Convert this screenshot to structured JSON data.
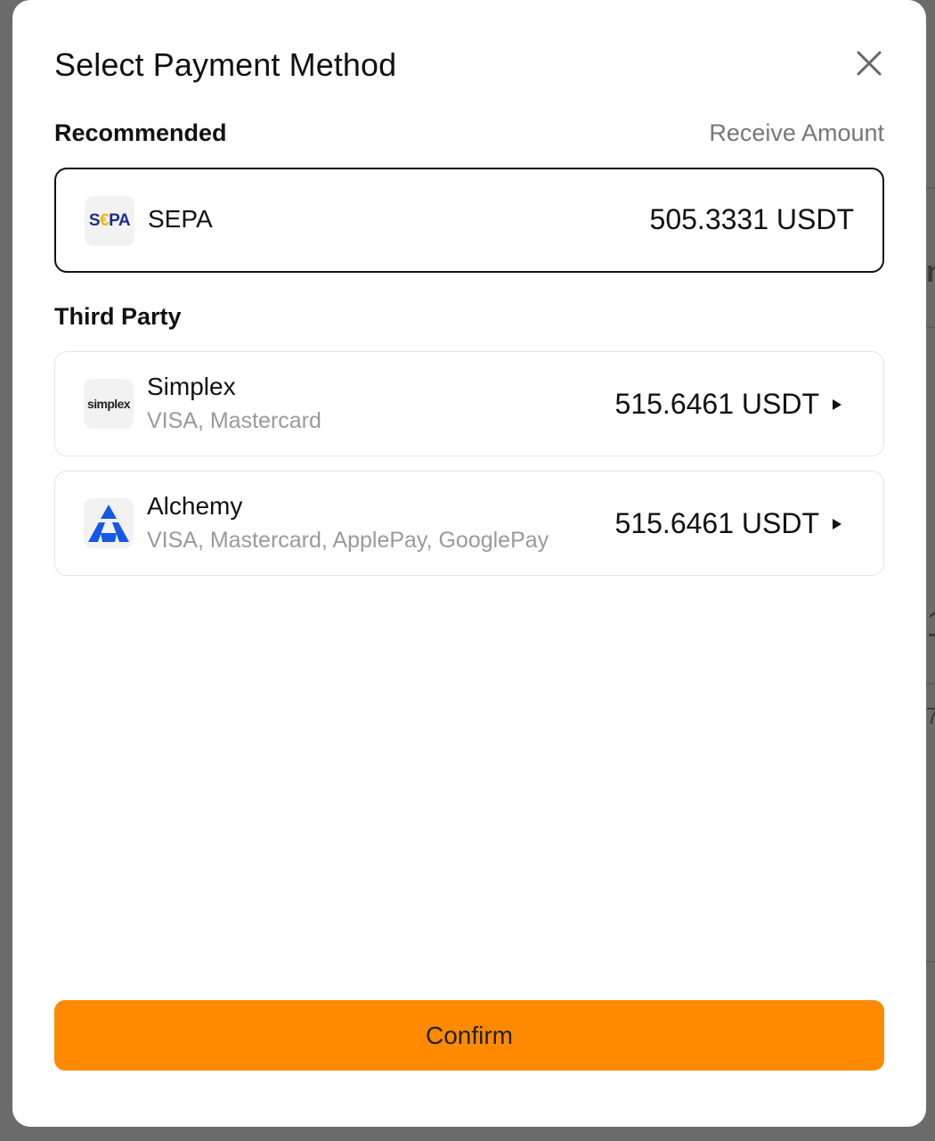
{
  "modal": {
    "title": "Select Payment Method",
    "close_icon": "close-icon"
  },
  "recommended": {
    "heading": "Recommended",
    "receive_label": "Receive Amount",
    "method": {
      "name": "SEPA",
      "logo_text": "S€PA",
      "amount": "505.3331 USDT"
    }
  },
  "third_party": {
    "heading": "Third Party",
    "methods": [
      {
        "name": "Simplex",
        "logo_text": "simplex",
        "subtitle": "VISA, Mastercard",
        "amount": "515.6461 USDT",
        "icon": "caret-right-icon"
      },
      {
        "name": "Alchemy",
        "logo_icon": "alchemy-logo-icon",
        "subtitle": "VISA, Mastercard, ApplePay, GooglePay",
        "amount": "515.6461 USDT",
        "icon": "caret-right-icon"
      }
    ]
  },
  "confirm_label": "Confirm",
  "colors": {
    "accent": "#ff8a00",
    "overlay": "#6b6b6b",
    "sepa_blue": "#1c2e8c",
    "sepa_yellow": "#f2b700",
    "alchemy_blue": "#1658e6"
  }
}
